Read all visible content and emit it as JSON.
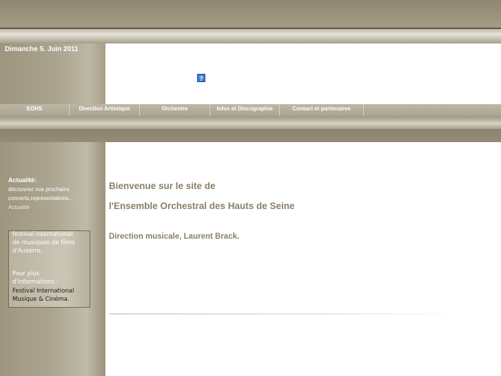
{
  "header": {
    "date": "Dimanche 5. Juin 2011",
    "broken_image_glyph": "?"
  },
  "nav": {
    "items": [
      {
        "label": "EOHS"
      },
      {
        "label": "Direction Artistique"
      },
      {
        "label": "Orchestre"
      },
      {
        "label": "Infos et Discographie"
      },
      {
        "label": "Contact et partenaires"
      }
    ]
  },
  "sidebar": {
    "title": "Actualité:",
    "line1": "découvrez nos prochains",
    "line2": "concerts,représentations...",
    "link": "Actualité",
    "news": {
      "l1": "festival international",
      "l2": "de musiques de films",
      "l3": "d'Auxerre.",
      "l4": "Pour plus",
      "l5": "d'informations :",
      "l6": "Festival International",
      "l7": "Musique & Cinéma."
    }
  },
  "main": {
    "welcome": "Bienvenue sur le site de",
    "ensemble": "l'Ensemble Orchestral des Hauts de Seine",
    "direction": "Direction musicale, Laurent Brack."
  },
  "colors": {
    "brand_brown": "#8a8068",
    "band_dark": "#8f8770",
    "white": "#ffffff"
  }
}
